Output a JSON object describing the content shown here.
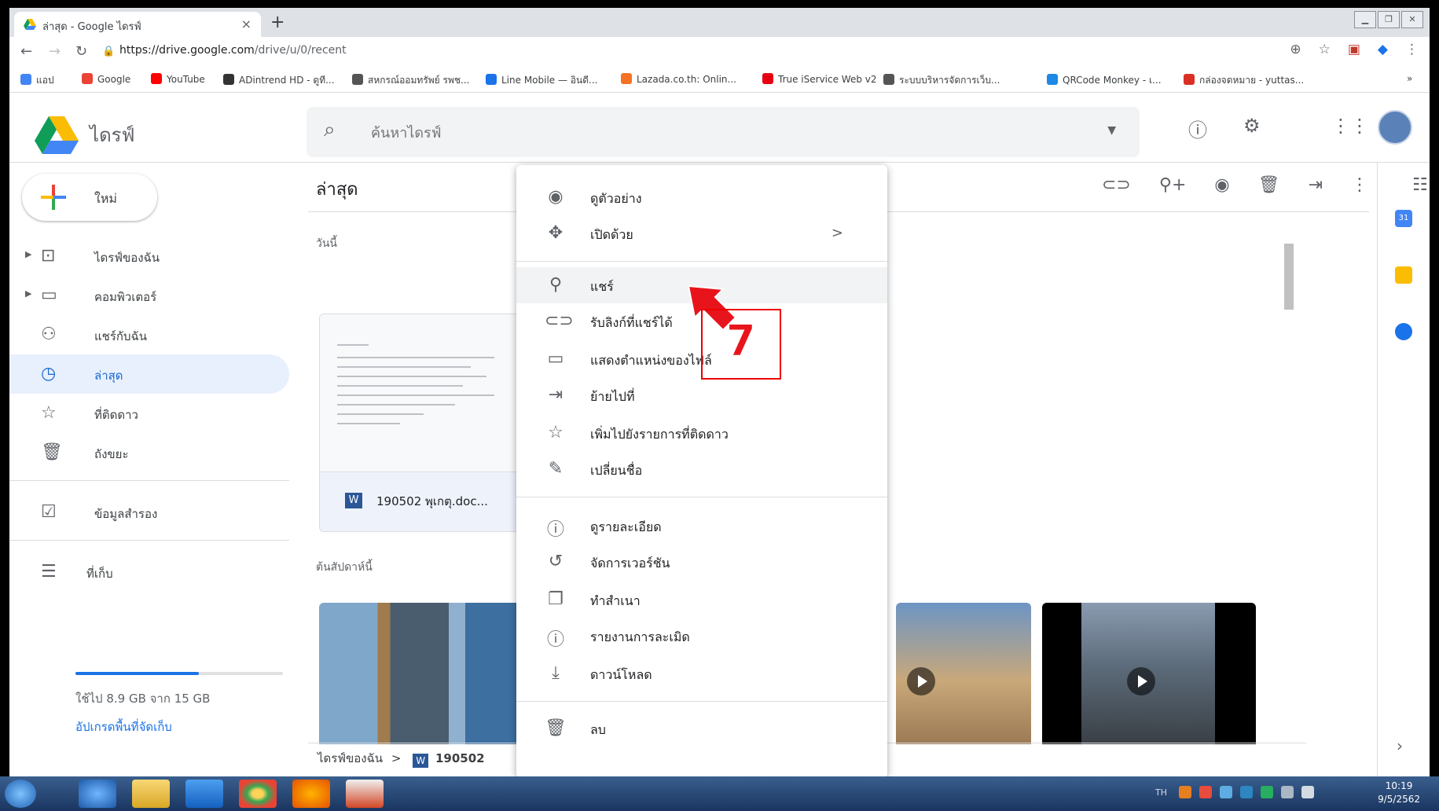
{
  "browser": {
    "tab_title": "ล่าสุด - Google ไดรฟ์",
    "tab_close": "×",
    "new_tab": "+",
    "url_domain": "https://drive.google.com",
    "url_path": "/drive/u/0/recent",
    "bookmarks": [
      {
        "label": "แอป",
        "color": "#4285f4"
      },
      {
        "label": "Google",
        "color": "#ea4335"
      },
      {
        "label": "YouTube",
        "color": "#ff0000"
      },
      {
        "label": "ADintrend HD - ดูที...",
        "color": "#333333"
      },
      {
        "label": "สหกรณ์ออมทรัพย์ รพช...",
        "color": "#555555"
      },
      {
        "label": "Line Mobile — อินดี...",
        "color": "#1a73e8"
      },
      {
        "label": "Lazada.co.th: Onlin...",
        "color": "#f57224"
      },
      {
        "label": "True iService Web v2",
        "color": "#e60012"
      },
      {
        "label": "ระบบบริหารจัดการเว็บ...",
        "color": "#555555"
      },
      {
        "label": "QRCode Monkey - เ...",
        "color": "#1e88e5"
      },
      {
        "label": "กล่องจดหมาย - yuttas...",
        "color": "#d93025"
      }
    ],
    "bookmarks_more": "»"
  },
  "drive": {
    "brand": "ไดรฟ์",
    "search_placeholder": "ค้นหาไดรฟ์",
    "page_title": "ล่าสุด",
    "new_button": "ใหม่",
    "sidebar": [
      {
        "label": "ไดรฟ์ของฉัน",
        "icon": "drive-icon"
      },
      {
        "label": "คอมพิวเตอร์",
        "icon": "computer-icon"
      },
      {
        "label": "แชร์กับฉัน",
        "icon": "shared-icon"
      },
      {
        "label": "ล่าสุด",
        "icon": "clock-icon"
      },
      {
        "label": "ที่ติดดาว",
        "icon": "star-icon"
      },
      {
        "label": "ถังขยะ",
        "icon": "trash-icon"
      },
      {
        "label": "ข้อมูลสำรอง",
        "icon": "backup-icon"
      },
      {
        "label": "ที่เก็บ",
        "icon": "storage-icon"
      }
    ],
    "storage_used_gb": 8.9,
    "storage_total_gb": 15,
    "storage_text": "ใช้ไป 8.9 GB จาก 15 GB",
    "upgrade_text": "อัปเกรดพื้นที่จัดเก็บ",
    "section_today": "วันนี้",
    "section_week": "ต้นสัปดาห์นี้",
    "file_name": "190502 พุเกตุ.doc...",
    "file_type_badge": "W",
    "breadcrumb_root": "ไดรฟ์ของฉัน",
    "breadcrumb_sep": ">",
    "breadcrumb_file": "190502"
  },
  "context_menu": {
    "items": [
      {
        "label": "ดูตัวอย่าง",
        "icon": "eye-icon"
      },
      {
        "label": "เปิดด้วย",
        "icon": "open-with-icon",
        "submenu": ">"
      },
      {
        "label": "แชร์",
        "icon": "share-person-icon"
      },
      {
        "label": "รับลิงก์ที่แชร์ได้",
        "icon": "link-icon"
      },
      {
        "label": "แสดงตำแหน่งของไฟล์",
        "icon": "folder-icon"
      },
      {
        "label": "ย้ายไปที่",
        "icon": "move-icon"
      },
      {
        "label": "เพิ่มไปยังรายการที่ติดดาว",
        "icon": "star-icon"
      },
      {
        "label": "เปลี่ยนชื่อ",
        "icon": "pencil-icon"
      },
      {
        "label": "ดูรายละเอียด",
        "icon": "info-icon"
      },
      {
        "label": "จัดการเวอร์ชัน",
        "icon": "history-icon"
      },
      {
        "label": "ทำสำเนา",
        "icon": "copy-icon"
      },
      {
        "label": "รายงานการละเมิด",
        "icon": "report-icon"
      },
      {
        "label": "ดาวน์โหลด",
        "icon": "download-icon"
      },
      {
        "label": "ลบ",
        "icon": "trash-icon"
      }
    ]
  },
  "annotation": {
    "step": "7"
  },
  "taskbar": {
    "lang": "TH",
    "time": "10:19",
    "date": "9/5/2562"
  }
}
